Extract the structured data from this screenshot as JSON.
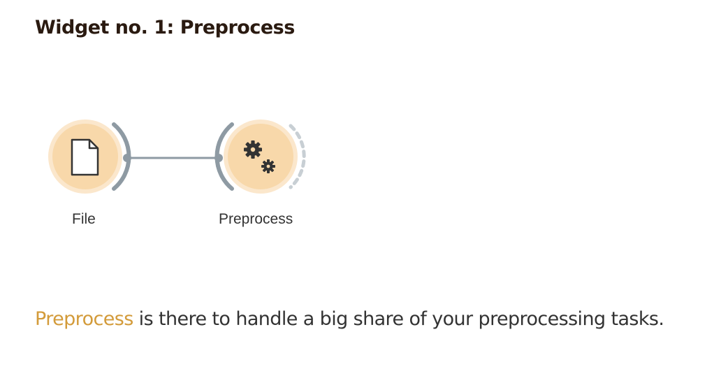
{
  "heading": {
    "title": "Widget no. 1: Preprocess"
  },
  "workflow": {
    "nodes": [
      {
        "label": "File",
        "icon": "document-icon"
      },
      {
        "label": "Preprocess",
        "icon": "gears-icon"
      }
    ],
    "colors": {
      "node_fill": "#f8d8aa",
      "node_glow": "#fbe7cc",
      "connector": "#8e9aa3",
      "icon": "#333333"
    }
  },
  "description": {
    "link_text": "Preprocess",
    "rest_text": " is there to handle a big share of your preprocessing tasks.",
    "link_color": "#d39b3a"
  }
}
